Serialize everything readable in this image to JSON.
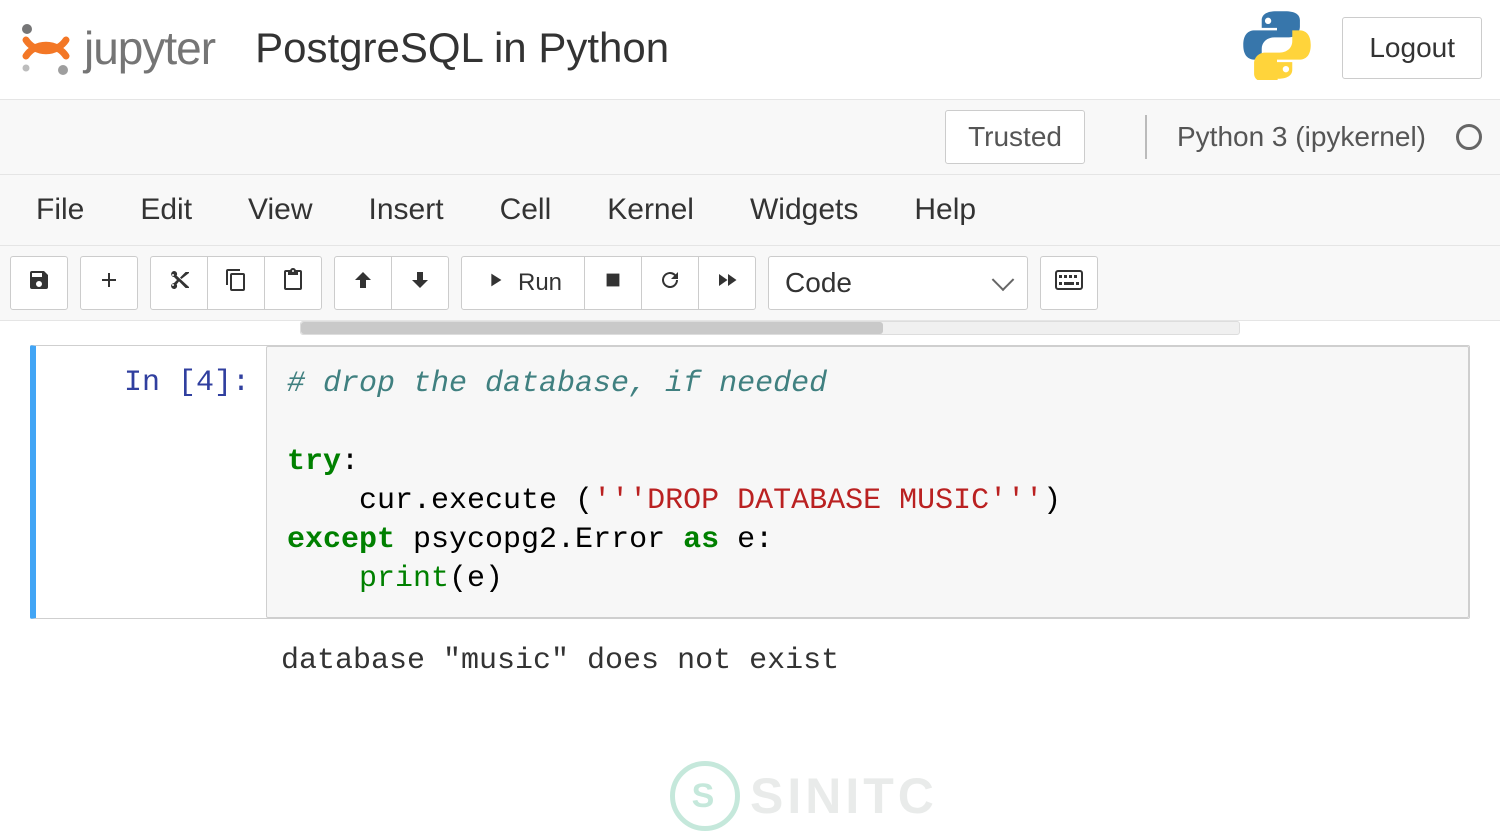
{
  "header": {
    "logo_text": "jupyter",
    "notebook_title": "PostgreSQL in Python",
    "logout_label": "Logout"
  },
  "trustbar": {
    "trusted_label": "Trusted",
    "kernel_name": "Python 3 (ipykernel)"
  },
  "menu": {
    "items": [
      "File",
      "Edit",
      "View",
      "Insert",
      "Cell",
      "Kernel",
      "Widgets",
      "Help"
    ]
  },
  "toolbar": {
    "run_label": "Run",
    "cell_type": "Code"
  },
  "cell": {
    "prompt": "In [4]:",
    "code_lines": {
      "l1_comment": "# drop the database, if needed",
      "l2": "",
      "l3_try": "try",
      "l3_colon": ":",
      "l4_indent": "    cur.execute (",
      "l4_string": "'''DROP DATABASE MUSIC'''",
      "l4_close": ")",
      "l5_except": "except",
      "l5_mid": " psycopg2.Error ",
      "l5_as": "as",
      "l5_end": " e:",
      "l6_indent": "    ",
      "l6_print": "print",
      "l6_args": "(e)"
    },
    "output": "database \"music\" does not exist"
  },
  "watermark": {
    "badge": "S",
    "text": "SINITC"
  }
}
